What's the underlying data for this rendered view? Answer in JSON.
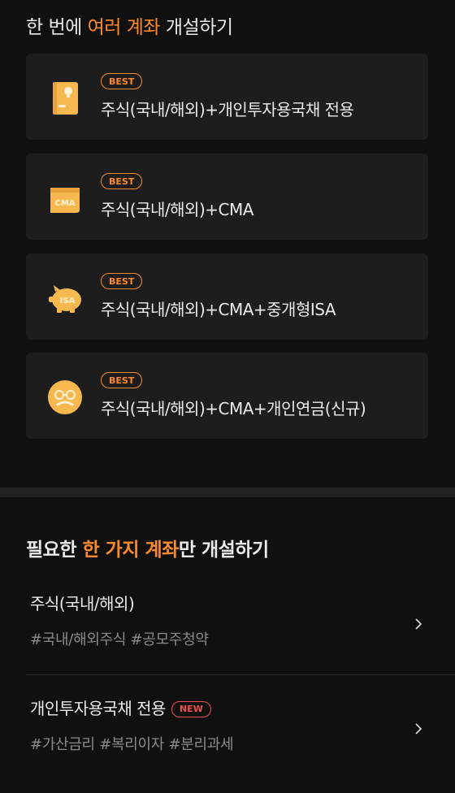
{
  "bundle_section": {
    "title_prefix": "한 번에 ",
    "title_accent": "여러 계좌",
    "title_suffix": " 개설하기",
    "cards": [
      {
        "badge": "BEST",
        "label": "주식(국내/해외)+개인투자용국채 전용",
        "icon": "bond-book-icon"
      },
      {
        "badge": "BEST",
        "label": "주식(국내/해외)+CMA",
        "icon": "cma-icon",
        "icon_text": "CMA"
      },
      {
        "badge": "BEST",
        "label": "주식(국내/해외)+CMA+중개형ISA",
        "icon": "piggy-bank-isa-icon",
        "icon_text": "ISA"
      },
      {
        "badge": "BEST",
        "label": "주식(국내/해외)+CMA+개인연금(신규)",
        "icon": "pension-face-icon"
      }
    ]
  },
  "single_section": {
    "title_prefix": "필요한 ",
    "title_accent": "한 가지 계좌",
    "title_suffix": "만 개설하기",
    "items": [
      {
        "name": "주식(국내/해외)",
        "tags": "#국내/해외주식 #공모주청약"
      },
      {
        "name": "개인투자용국채 전용",
        "badge": "NEW",
        "tags": "#가산금리 #복리이자 #분리과세"
      }
    ]
  },
  "colors": {
    "accent": "#f98a2c",
    "icon": "#f7b84f",
    "new_badge": "#f24e4e",
    "background": "#101010",
    "card": "#1d1d1d"
  }
}
